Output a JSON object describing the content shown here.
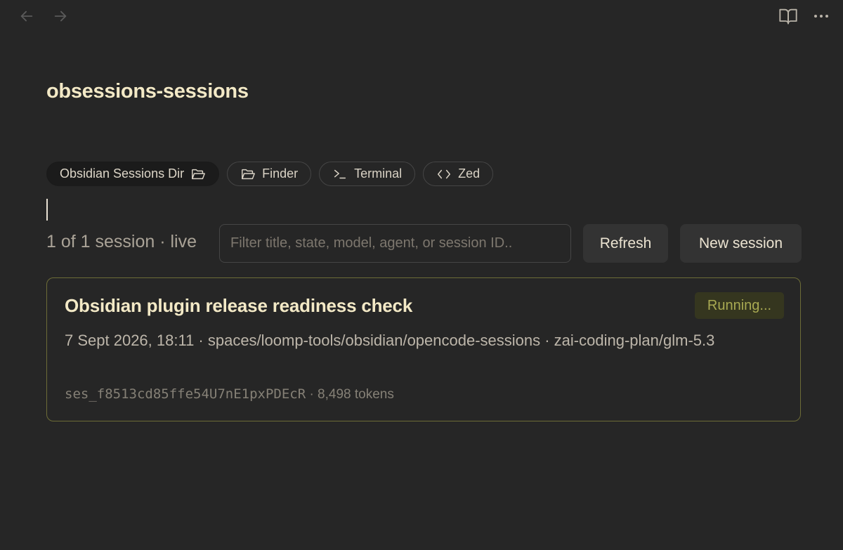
{
  "toolbar": {
    "back_icon": "arrow-left-icon",
    "forward_icon": "arrow-right-icon",
    "reading_icon": "book-open-icon",
    "more_icon": "more-horizontal-icon"
  },
  "note": {
    "title": "obsessions-sessions"
  },
  "chips": [
    {
      "label": "Obsidian Sessions Dir",
      "icon": "folder-open-icon"
    },
    {
      "label": "Finder",
      "icon": "folder-open-icon"
    },
    {
      "label": "Terminal",
      "icon": "terminal-icon"
    },
    {
      "label": "Zed",
      "icon": "code-icon"
    }
  ],
  "controls": {
    "session_count": "1 of 1 session · live",
    "filter_placeholder": "Filter title, state, model, agent, or session ID..",
    "filter_value": "",
    "refresh_label": "Refresh",
    "new_session_label": "New session"
  },
  "sessions": [
    {
      "title": "Obsidian plugin release readiness check",
      "status": "Running...",
      "meta": "7 Sept 2026, 18:11 · spaces/loomp-tools/obsidian/opencode-sessions · zai-coding-plan/glm-5.3",
      "session_id": "ses_f8513cd85ffe54U7nE1pxPDEcR",
      "tokens": " · 8,498 tokens"
    }
  ],
  "colors": {
    "background": "#262626",
    "title": "#f3e9c6",
    "card_border": "#6d6c37",
    "status_badge_bg": "#35361f",
    "status_badge_text": "#a8a952"
  }
}
